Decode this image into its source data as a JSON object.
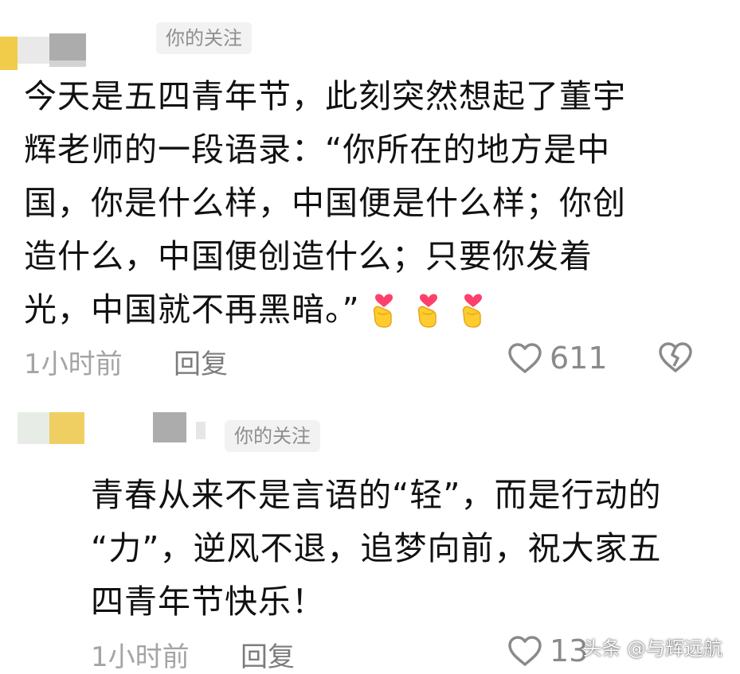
{
  "comments": [
    {
      "badge": "你的关注",
      "text_lines": [
        "今天是五四青年节，此刻突然想起了董宇",
        "辉老师的一段语录：“你所在的地方是中",
        "国，你是什么样，中国便是什么样；你创",
        "造什么，中国便创造什么；只要你发着",
        "光，中国就不再黑暗。”"
      ],
      "emoji": [
        "finger-heart-emoji",
        "finger-heart-emoji",
        "finger-heart-emoji"
      ],
      "time": "1小时前",
      "reply_label": "回复",
      "like_count": "611"
    },
    {
      "badge": "你的关注",
      "text_lines": [
        "青春从来不是言语的“轻”，而是行动的",
        "“力”，逆风不退，追梦向前，祝大家五",
        "四青年节快乐！"
      ],
      "time": "1小时前",
      "reply_label": "回复",
      "like_count": "13"
    }
  ],
  "watermark": "头条 @与辉远航",
  "colors": {
    "accent_yellow": "#f1cc4a",
    "mosaic_gray": "#ababab",
    "meta_gray": "#a4a4a4"
  }
}
